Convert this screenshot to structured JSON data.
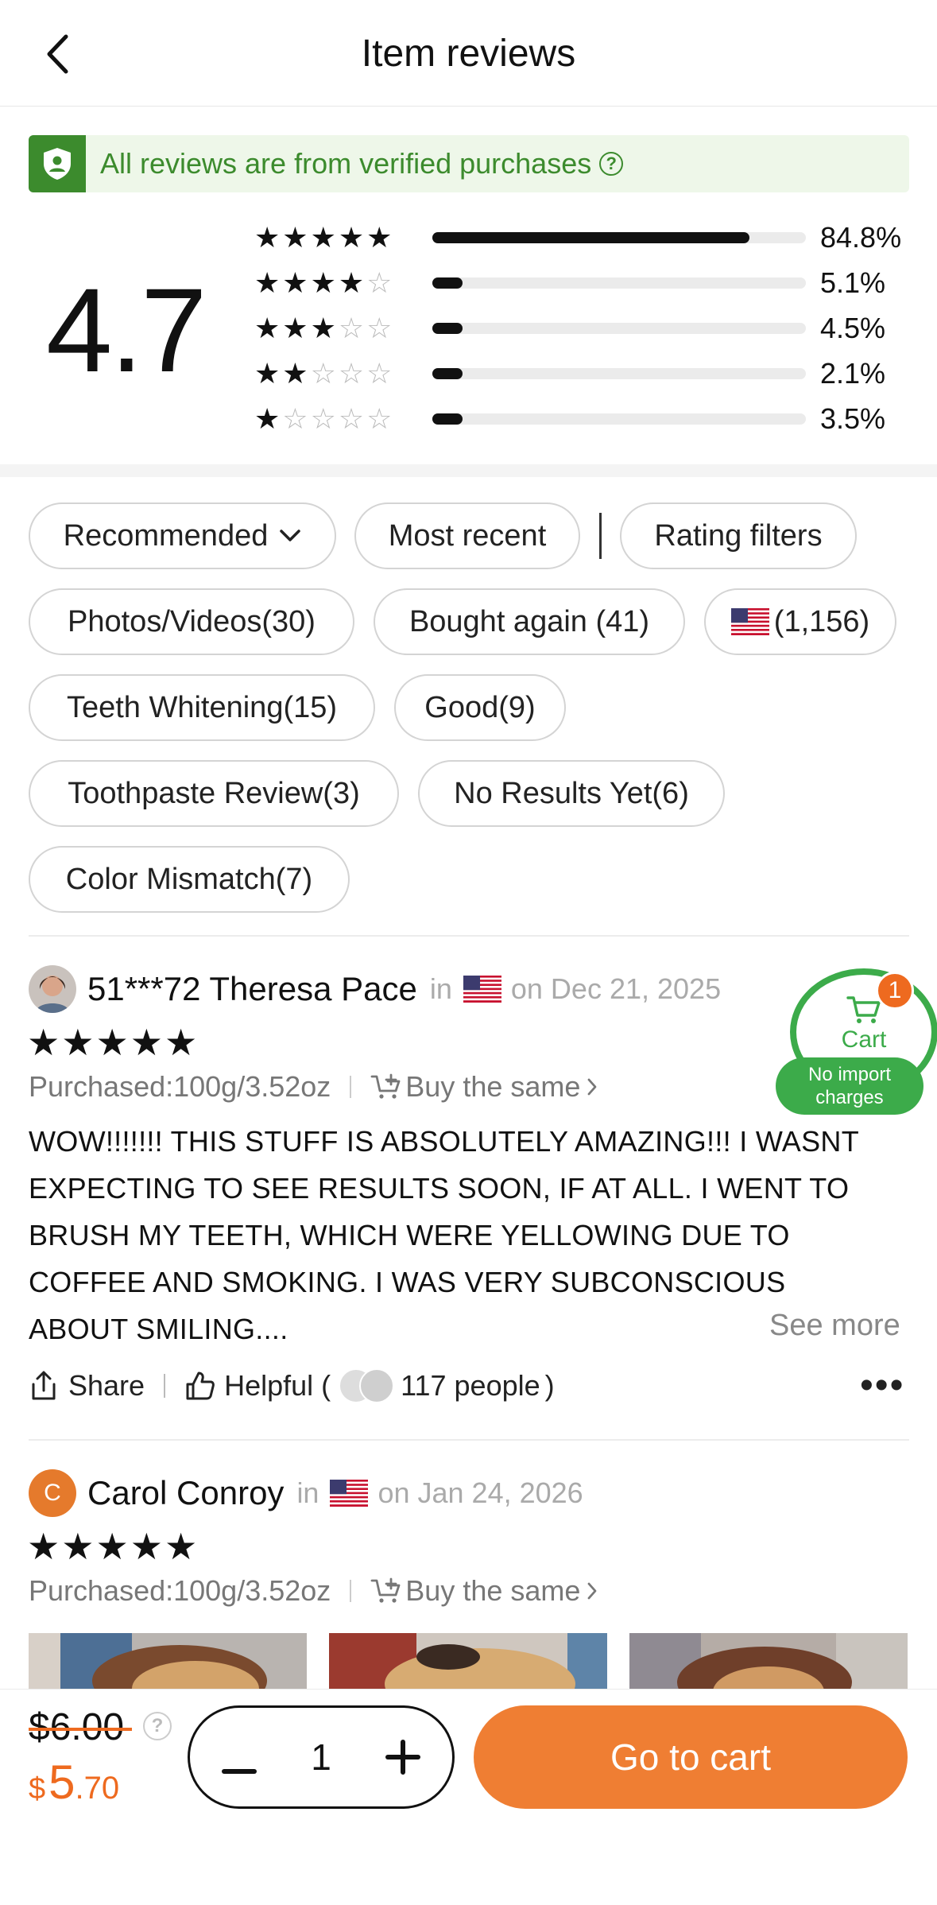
{
  "header": {
    "title": "Item reviews"
  },
  "verified": {
    "text": "All reviews are from verified purchases"
  },
  "summary": {
    "average": "4.7",
    "rows": [
      {
        "stars": 5,
        "fraction": 0.848,
        "percent": "84.8%"
      },
      {
        "stars": 4,
        "fraction": 0.051,
        "percent": "5.1%"
      },
      {
        "stars": 3,
        "fraction": 0.045,
        "percent": "4.5%"
      },
      {
        "stars": 2,
        "fraction": 0.021,
        "percent": "2.1%"
      },
      {
        "stars": 1,
        "fraction": 0.035,
        "percent": "3.5%"
      }
    ]
  },
  "filters": {
    "recommended": "Recommended",
    "most_recent": "Most recent",
    "rating_filters": "Rating filters",
    "photos_videos": "Photos/Videos(30)",
    "bought_again": "Bought again (41)",
    "country": "(1,156)",
    "teeth_whitening": "Teeth Whitening(15)",
    "good": "Good(9)",
    "toothpaste_review": "Toothpaste Review(3)",
    "no_results_yet": "No Results Yet(6)",
    "color_mismatch": "Color Mismatch(7)"
  },
  "reviews": [
    {
      "name": "51***72 Theresa Pace",
      "in": "in",
      "date": "on Dec 21, 2025",
      "stars": "★★★★★",
      "purchased": "Purchased:100g/3.52oz",
      "buy_same": "Buy the same",
      "text": "WOW!!!!!!! THIS STUFF IS ABSOLUTELY AMAZING!!! I WASNT EXPECTING TO SEE RESULTS SOON, IF AT ALL. I WENT TO BRUSH MY TEETH, WHICH WERE YELLOWING DUE TO COFFEE AND SMOKING. I WAS VERY SUBCONSCIOUS ABOUT SMILING....",
      "see_more": "See more",
      "share": "Share",
      "helpful_prefix": "Helpful (",
      "helpful_count": "117 people",
      "helpful_suffix": ")"
    },
    {
      "initial": "C",
      "name": "Carol Conroy",
      "in": "in",
      "date": "on Jan 24, 2026",
      "stars": "★★★★★",
      "purchased": "Purchased:100g/3.52oz",
      "buy_same": "Buy the same"
    }
  ],
  "floating_cart": {
    "label": "Cart",
    "badge": "1",
    "tag": "No import charges"
  },
  "bottom": {
    "old_price": "$6.00",
    "currency": "$",
    "price_main": "5",
    "price_cents": ".70",
    "quantity": "1",
    "go_to_cart": "Go to cart"
  },
  "colors": {
    "accent_orange": "#ef7e33",
    "verified_green": "#3c8b2d",
    "cart_green": "#3cab4a"
  }
}
